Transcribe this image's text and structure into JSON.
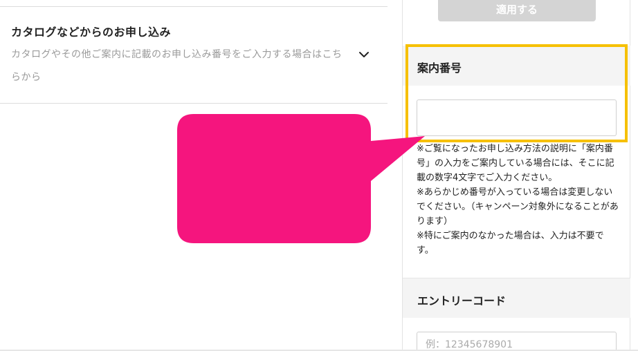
{
  "catalog": {
    "title": "カタログなどからのお申し込み",
    "description": "カタログやその他ご案内に記載のお申し込み番号をご入力する場合はこちらから"
  },
  "sidebar": {
    "apply_button_label": "適用する",
    "annai": {
      "heading": "案内番号",
      "input_value": "",
      "notes": [
        "※ご覧になったお申し込み方法の説明に「案内番号」の入力をご案内している場合には、そこに記載の数字4文字でご入力ください。",
        "※あらかじめ番号が入っている場合は変更しないでください。（キャンペーン対象外になることがあります）",
        "※特にご案内のなかった場合は、入力は不要です。"
      ]
    },
    "entry": {
      "heading": "エントリーコード",
      "placeholder": "例：12345678901"
    }
  },
  "colors": {
    "callout": "#f5157e",
    "highlight": "#f6c000",
    "disabled_button": "#d4d4d4"
  },
  "icons": {
    "expand": "chevron-down-icon"
  }
}
